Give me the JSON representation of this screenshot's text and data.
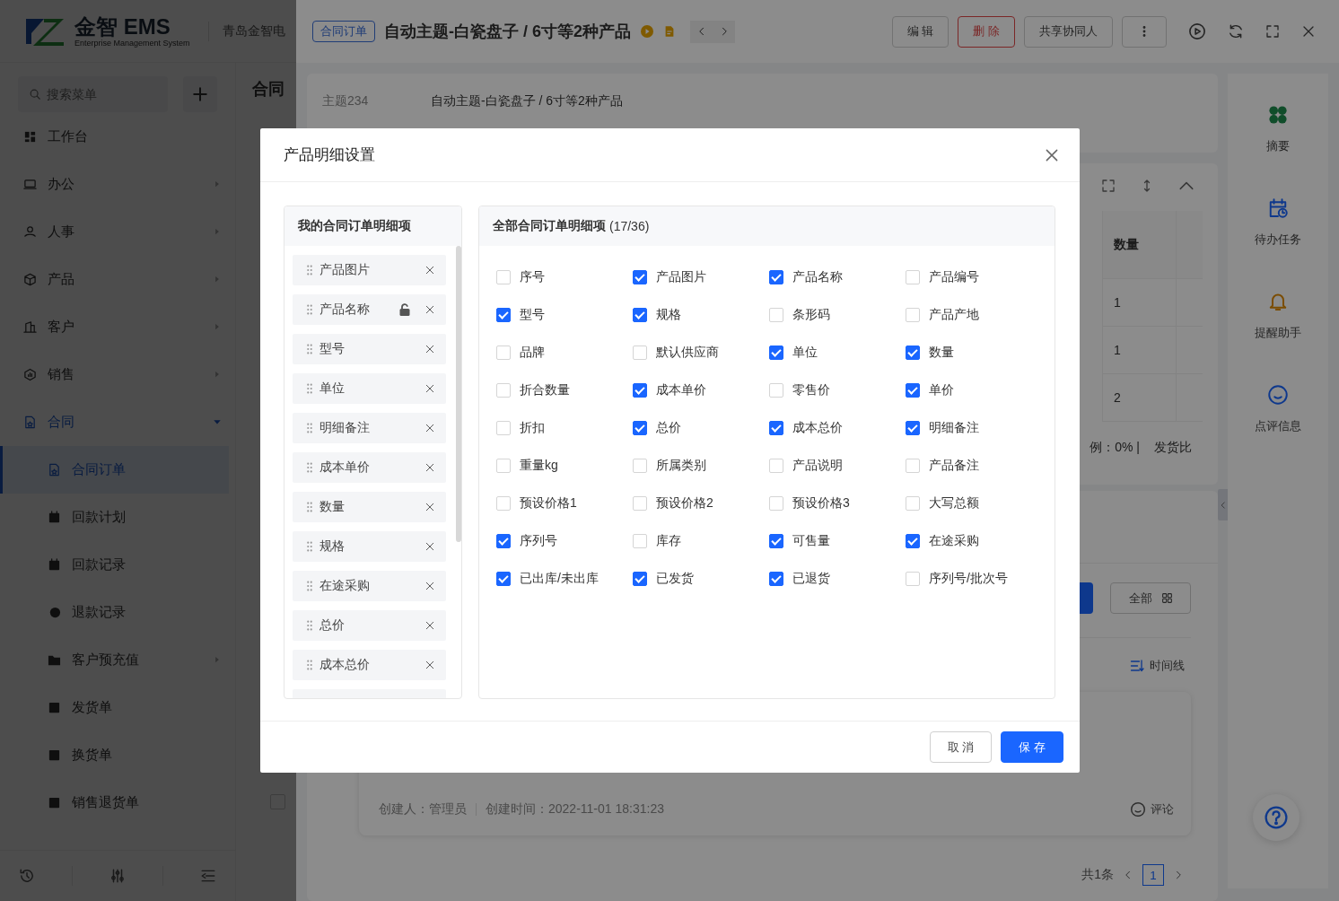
{
  "app": {
    "logo_text": "金智 EMS",
    "logo_subtitle": "Enterprise Management System",
    "company": "青岛金智电",
    "search": {
      "placeholder": "搜索菜单"
    },
    "menu": [
      {
        "label": "工作台",
        "kind": "link",
        "selected": false
      },
      {
        "label": "办公",
        "kind": "group",
        "expanded": false,
        "selected": false
      },
      {
        "label": "人事",
        "kind": "group",
        "expanded": false,
        "selected": false
      },
      {
        "label": "产品",
        "kind": "group",
        "expanded": false,
        "selected": false
      },
      {
        "label": "客户",
        "kind": "group",
        "expanded": false,
        "selected": false
      },
      {
        "label": "销售",
        "kind": "group",
        "expanded": false,
        "selected": false
      },
      {
        "label": "合同",
        "kind": "group",
        "expanded": true,
        "selected": false,
        "children": [
          {
            "label": "合同订单",
            "kind": "link",
            "selected": true
          },
          {
            "label": "回款计划",
            "kind": "link",
            "selected": false
          },
          {
            "label": "回款记录",
            "kind": "link",
            "selected": false
          },
          {
            "label": "退款记录",
            "kind": "link",
            "selected": false
          },
          {
            "label": "客户预充值",
            "kind": "group",
            "expanded": false,
            "selected": false
          },
          {
            "label": "发货单",
            "kind": "link",
            "selected": false
          },
          {
            "label": "换货单",
            "kind": "link",
            "selected": false
          },
          {
            "label": "销售退货单",
            "kind": "link",
            "selected": false
          }
        ]
      }
    ],
    "list_title": "合同",
    "list_checkbox": {
      "checked": false
    }
  },
  "drawer": {
    "tag": "合同订单",
    "title": "自动主题-白瓷盘子 / 6寸等2种产品",
    "buttons": [
      {
        "label": "编 辑",
        "kind": "default"
      },
      {
        "label": "删 除",
        "kind": "danger"
      },
      {
        "label": "共享协同人",
        "kind": "default"
      }
    ],
    "info": [
      {
        "label": "主题234",
        "value": "自动主题-白瓷盘子 / 6寸等2种产品",
        "kind": "text"
      }
    ],
    "product_table": {
      "columns": [
        "数量"
      ],
      "rows": [
        [
          "1"
        ],
        [
          "1"
        ],
        [
          "2"
        ]
      ]
    },
    "summary": [
      "例：0% |",
      "发货比"
    ],
    "filter_button": "全部",
    "timeline_button": "时间线",
    "comment": {
      "creator": "创建人：管理员",
      "created": "创建时间：2022-11-01 18:31:23",
      "comment_button": "评论"
    },
    "pagination": {
      "total": "共1条",
      "pages": [
        {
          "label": "1",
          "selected": true
        }
      ]
    },
    "rail": [
      {
        "label": "摘要"
      },
      {
        "label": "待办任务"
      },
      {
        "label": "提醒助手"
      },
      {
        "label": "点评信息"
      }
    ]
  },
  "modal": {
    "title": "产品明细设置",
    "my_items": {
      "title": "我的合同订单明细项",
      "items": [
        {
          "label": "产品图片",
          "locked": false
        },
        {
          "label": "产品名称",
          "locked": true
        },
        {
          "label": "型号",
          "locked": false
        },
        {
          "label": "单位",
          "locked": false
        },
        {
          "label": "明细备注",
          "locked": false
        },
        {
          "label": "成本单价",
          "locked": false
        },
        {
          "label": "数量",
          "locked": false
        },
        {
          "label": "规格",
          "locked": false
        },
        {
          "label": "在途采购",
          "locked": false
        },
        {
          "label": "总价",
          "locked": false
        },
        {
          "label": "成本总价",
          "locked": false
        }
      ]
    },
    "all_items": {
      "title": "全部合同订单明细项",
      "count": "(17/36)",
      "items": [
        {
          "label": "序号",
          "checked": false
        },
        {
          "label": "产品图片",
          "checked": true
        },
        {
          "label": "产品名称",
          "checked": true
        },
        {
          "label": "产品编号",
          "checked": false
        },
        {
          "label": "型号",
          "checked": true
        },
        {
          "label": "规格",
          "checked": true
        },
        {
          "label": "条形码",
          "checked": false
        },
        {
          "label": "产品产地",
          "checked": false
        },
        {
          "label": "品牌",
          "checked": false
        },
        {
          "label": "默认供应商",
          "checked": false
        },
        {
          "label": "单位",
          "checked": true
        },
        {
          "label": "数量",
          "checked": true
        },
        {
          "label": "折合数量",
          "checked": false
        },
        {
          "label": "成本单价",
          "checked": true
        },
        {
          "label": "零售价",
          "checked": false
        },
        {
          "label": "单价",
          "checked": true
        },
        {
          "label": "折扣",
          "checked": false
        },
        {
          "label": "总价",
          "checked": true
        },
        {
          "label": "成本总价",
          "checked": true
        },
        {
          "label": "明细备注",
          "checked": true
        },
        {
          "label": "重量kg",
          "checked": false
        },
        {
          "label": "所属类别",
          "checked": false
        },
        {
          "label": "产品说明",
          "checked": false
        },
        {
          "label": "产品备注",
          "checked": false
        },
        {
          "label": "预设价格1",
          "checked": false
        },
        {
          "label": "预设价格2",
          "checked": false
        },
        {
          "label": "预设价格3",
          "checked": false
        },
        {
          "label": "大写总额",
          "checked": false
        },
        {
          "label": "序列号",
          "checked": true
        },
        {
          "label": "库存",
          "checked": false
        },
        {
          "label": "可售量",
          "checked": true
        },
        {
          "label": "在途采购",
          "checked": true
        },
        {
          "label": "已出库/未出库",
          "checked": true
        },
        {
          "label": "已发货",
          "checked": true
        },
        {
          "label": "已退货",
          "checked": true
        },
        {
          "label": "序列号/批次号",
          "checked": false
        }
      ]
    },
    "buttons": [
      {
        "label": "取 消",
        "kind": "default"
      },
      {
        "label": "保 存",
        "kind": "primary"
      }
    ]
  }
}
